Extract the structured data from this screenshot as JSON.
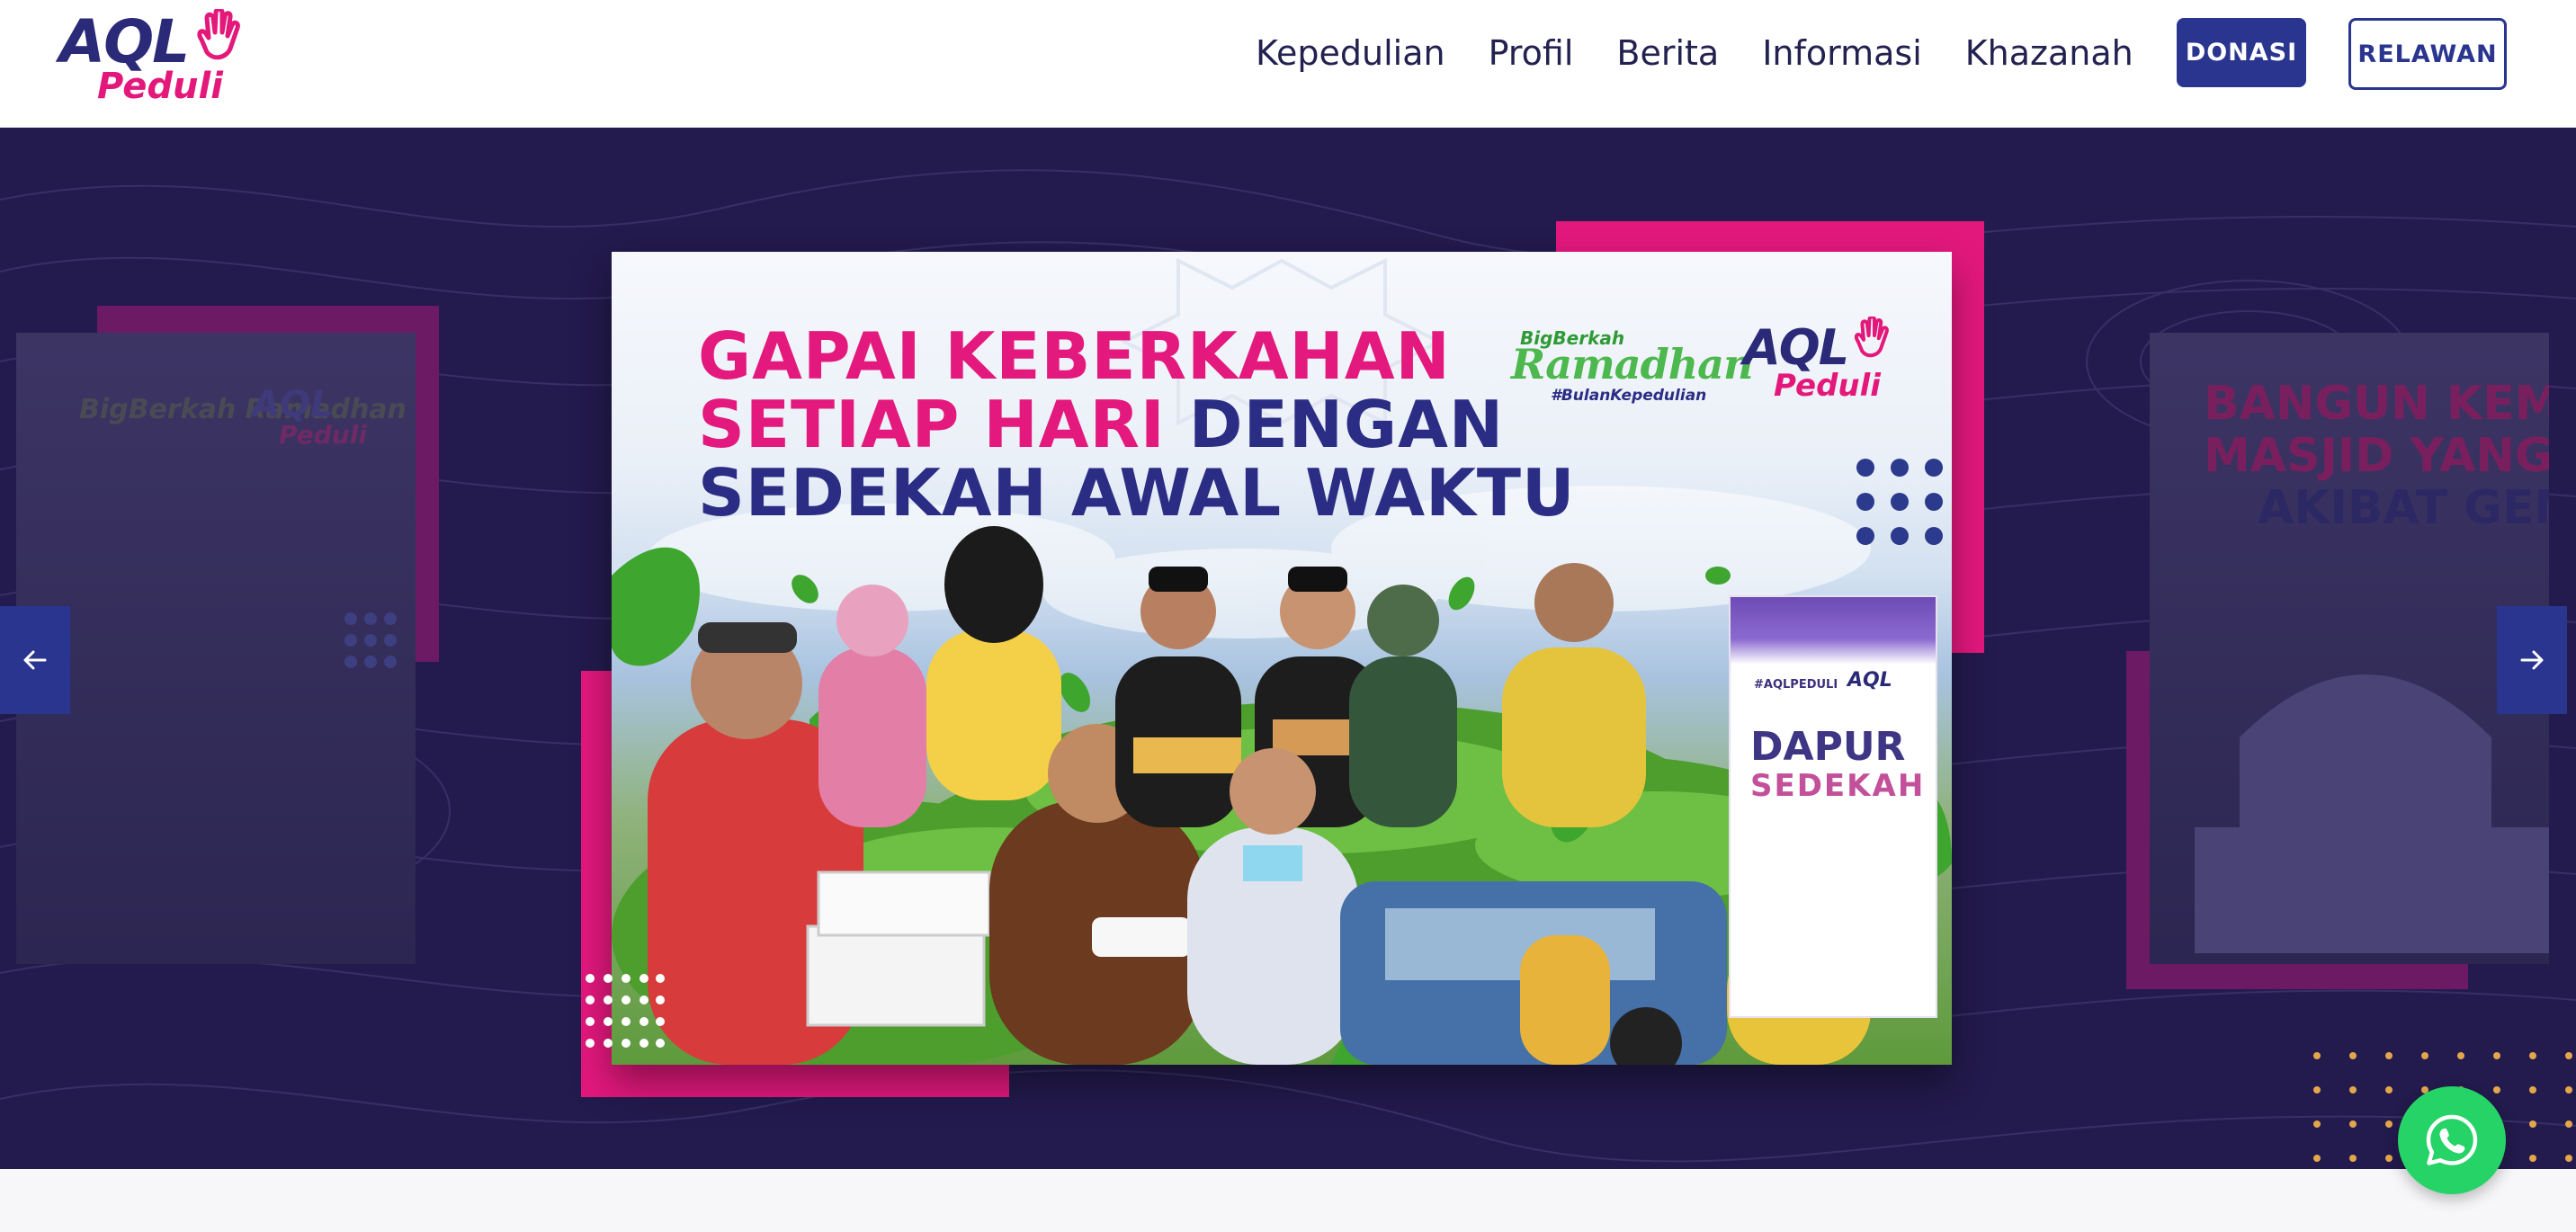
{
  "brand": {
    "logo_main": "AQL",
    "logo_sub": "Peduli"
  },
  "nav": {
    "items": [
      {
        "label": "Kepedulian"
      },
      {
        "label": "Profil"
      },
      {
        "label": "Berita"
      },
      {
        "label": "Informasi"
      },
      {
        "label": "Khazanah"
      }
    ],
    "donate_button": "DONASI",
    "volunteer_button": "RELAWAN"
  },
  "hero": {
    "active_slide": {
      "headline_line1": "GAPAI KEBERKAHAN",
      "headline_line2_pink": "SETIAP HARI",
      "headline_line2_navy": "DENGAN",
      "headline_line3": "SEDEKAH AWAL WAKTU",
      "campaign_top": "BigBerkah",
      "campaign_main": "Ramadhan",
      "campaign_tag": "#BulanKepedulian",
      "slide_logo_main": "AQL",
      "slide_logo_sub": "Peduli",
      "banner_org": "#AQLPEDULI",
      "banner_logo": "AQL",
      "banner_title1": "DAPUR",
      "banner_title2": "SEDEKAH"
    },
    "left_slide": {
      "logo_main": "AQL",
      "logo_sub": "Peduli",
      "campaign_text": "BigBerkah Ramadhan"
    },
    "right_slide": {
      "line1": "BANGUN KEM",
      "line2": "MASJID YANG",
      "line3": "AKIBAT GEMPA"
    },
    "prev_arrow_icon": "arrow-left-icon",
    "next_arrow_icon": "arrow-right-icon"
  },
  "floating": {
    "whatsapp_icon": "whatsapp-icon"
  },
  "colors": {
    "primary": "#2a3590",
    "accent_pink": "#e3187d",
    "hero_bg": "#231a4d",
    "whatsapp": "#25d366"
  }
}
